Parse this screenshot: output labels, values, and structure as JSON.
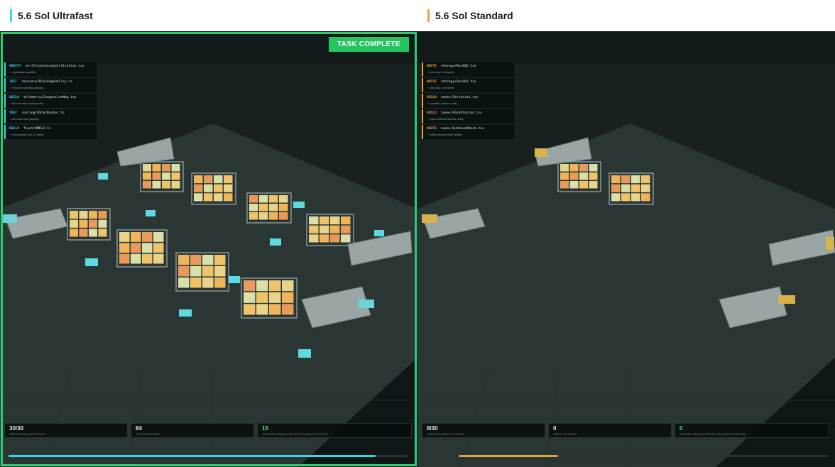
{
  "colors": {
    "ultrafast_accent": "#3ad6e4",
    "standard_accent": "#e8a33a",
    "complete_green": "#22c55e",
    "background": "#17201f"
  },
  "panels": [
    {
      "title": "5.6 Sol Ultrafast",
      "badge": "TASK COMPLETE",
      "log": [
        {
          "tag": "VERIFY",
          "file": "verification/qualification.tsx",
          "detail": "✓ application qualified"
        },
        {
          "tag": "TEST",
          "file": "recovery/BlockagePolicy.ts",
          "detail": "✓ recovery scenario passing"
        },
        {
          "tag": "BUILD",
          "file": "telemetry/CongestionMap.tsx",
          "detail": "✓ flow density overlay ready"
        },
        {
          "tag": "TEST",
          "file": "routing/AStarRouter.ts",
          "detail": "✓ 84 route tests passing"
        },
        {
          "tag": "BUILD",
          "file": "fleet/AMR12.ts",
          "detail": "✓ autonomous unit 12 online"
        }
      ],
      "stats": [
        {
          "value": "30/30",
          "label": "VERIFIED BUILD EVENTS"
        },
        {
          "value": "84",
          "label": "TESTS PASSING"
        },
        {
          "value": "15",
          "label": "ORDERS SIMULATED AFTER QUALIFICATION"
        }
      ],
      "progress": 0.92
    },
    {
      "title": "5.6 Sol Standard",
      "log": [
        {
          "tag": "WRITE",
          "file": "storage/Rack02.tsx",
          "detail": "✓ rack bay 2 compiled"
        },
        {
          "tag": "WRITE",
          "file": "storage/Rack01.tsx",
          "detail": "✓ rack bay 1 compiled"
        },
        {
          "tag": "BUILD",
          "file": "zones/Sortation.tsx",
          "detail": "✓ sortation surface ready"
        },
        {
          "tag": "BUILD",
          "file": "zones/PackStation.tsx",
          "detail": "✓ pack workflow surface ready"
        },
        {
          "tag": "WRITE",
          "file": "zones/OutboundDock.tsx",
          "detail": "✓ outbound geometry verified"
        }
      ],
      "stats": [
        {
          "value": "8/30",
          "label": "VERIFIED BUILD EVENTS"
        },
        {
          "value": "0",
          "label": "TESTS PASSING"
        },
        {
          "value": "0",
          "label": "ORDERS SIMULATED AFTER QUALIFICATION"
        }
      ],
      "progress": 0.27
    }
  ]
}
